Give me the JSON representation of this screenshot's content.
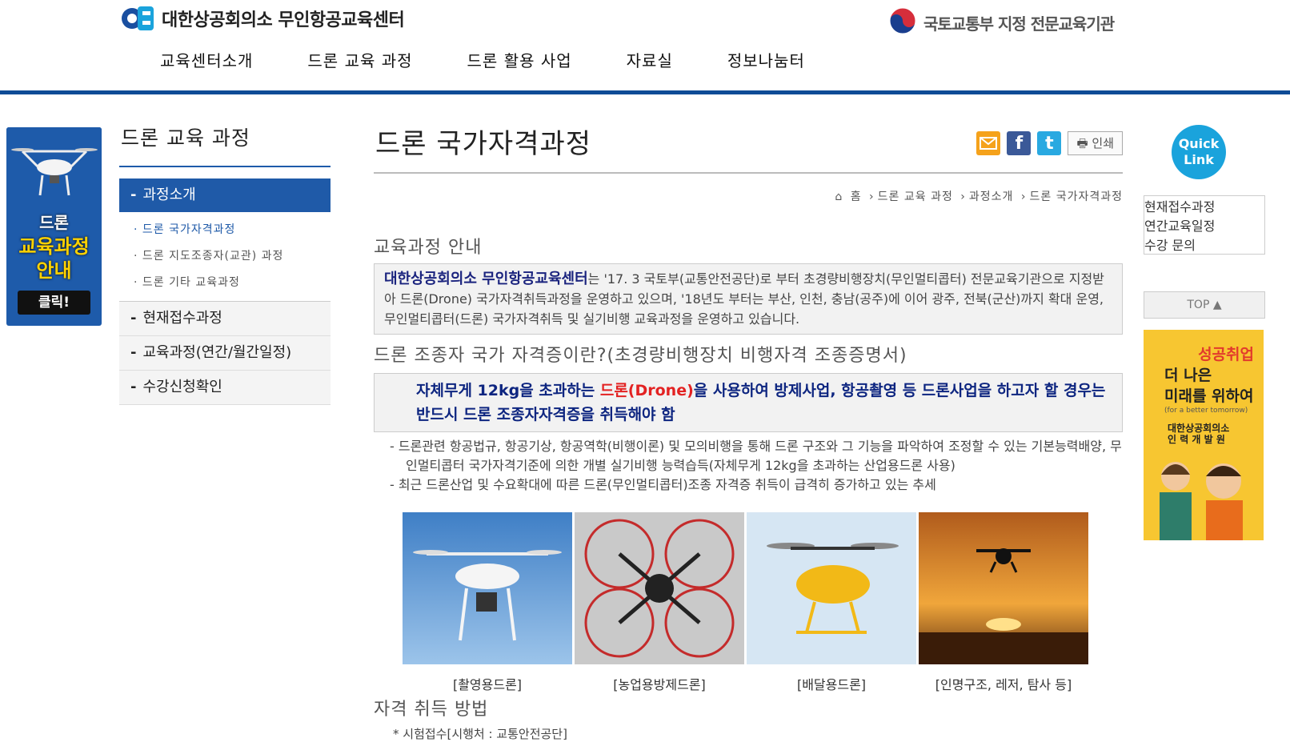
{
  "header": {
    "logo_text": "대한상공회의소  무인항공교육센터",
    "ministry_text": "국토교통부 지정 전문교육기관",
    "nav": [
      "교육센터소개",
      "드론 교육 과정",
      "드론 활용 사업",
      "자료실",
      "정보나눔터"
    ]
  },
  "left_banner": {
    "line1": "드론",
    "line2": "교육과정",
    "line3": "안내",
    "button": "클릭!"
  },
  "sidebar": {
    "title": "드론 교육 과정",
    "active": "과정소개",
    "sub_items": [
      "드론 국가자격과정",
      "드론 지도조종자(교관) 과정",
      "드론 기타 교육과정"
    ],
    "items": [
      "현재접수과정",
      "교육과정(연간/월간일정)",
      "수강신청확인"
    ]
  },
  "content": {
    "page_title": "드론 국가자격과정",
    "print_label": "인쇄",
    "breadcrumb": [
      "홈",
      "드론 교육 과정",
      "과정소개",
      "드론 국가자격과정"
    ],
    "section1_title": "교육과정 안내",
    "intro_bold": "대한상공회의소 무인항공교육센터",
    "intro_text": "는 '17. 3 국토부(교통안전공단)로 부터 초경량비행장치(무인멀티콥터) 전문교육기관으로 지정받아 드론(Drone) 국가자격취득과정을 운영하고 있으며, '18년도 부터는 부산, 인천, 충남(공주)에 이어 광주, 전북(군산)까지 확대 운영, 무인멀티콥터(드론) 국가자격취득 및 실기비행 교육과정을 운영하고 있습니다.",
    "section2_title": "드론 조종자 국가 자격증이란?(초경량비행장치 비행자격 조종증명서)",
    "alert_pre": "자체무게 12kg을 초과하는 ",
    "alert_red": "드론(Drone)",
    "alert_post": "을 사용하여 방제사업, 항공촬영 등 드론사업을 하고자 할 경우는 반드시 드론 조종자자격증을 취득해야 함",
    "bullets": [
      "-  드론관련 항공법규, 항공기상, 항공역학(비행이론) 및 모의비행을 통해 드론 구조와 그 기능을 파악하여 조정할 수 있는 기본능력배양, 무인멀티콥터 국가자격기준에 의한 개별 실기비행 능력습득(자체무게 12kg을 초과하는 산업용드론 사용)",
      "-  최근 드론산업 및 수요확대에 따른 드론(무인멀티콥터)조종 자격증 취득이 급격히 증가하고 있는 추세"
    ],
    "photos": [
      {
        "caption": "[촬영용드론]"
      },
      {
        "caption": "[농업용방제드론]"
      },
      {
        "caption": "[배달용드론]"
      },
      {
        "caption": "[인명구조, 레저, 탐사 등]"
      }
    ],
    "section3_title": "자격 취득 방법",
    "note": "* 시험접수[시행처 : 교통안전공단]"
  },
  "quick": {
    "circle_line1": "Quick",
    "circle_line2": "Link",
    "items": [
      "현재접수과정",
      "연간교육일정",
      "수강 문의"
    ],
    "top": "TOP ▲"
  },
  "right_banner": {
    "line1": "성공취업",
    "line2": "더 나은",
    "line3": "미래를 위하여",
    "line4": "(for a better tomorrow)",
    "line5": "대한상공회의소",
    "line6": "인 력 개 발 원"
  },
  "colors": {
    "brand_blue": "#0e4c96",
    "sidebar_active": "#1f5aa8",
    "alert_text": "#0d2580",
    "alert_red": "#e32222",
    "quick_circle": "#1aa3dc",
    "banner_yellow": "#f7c631"
  }
}
